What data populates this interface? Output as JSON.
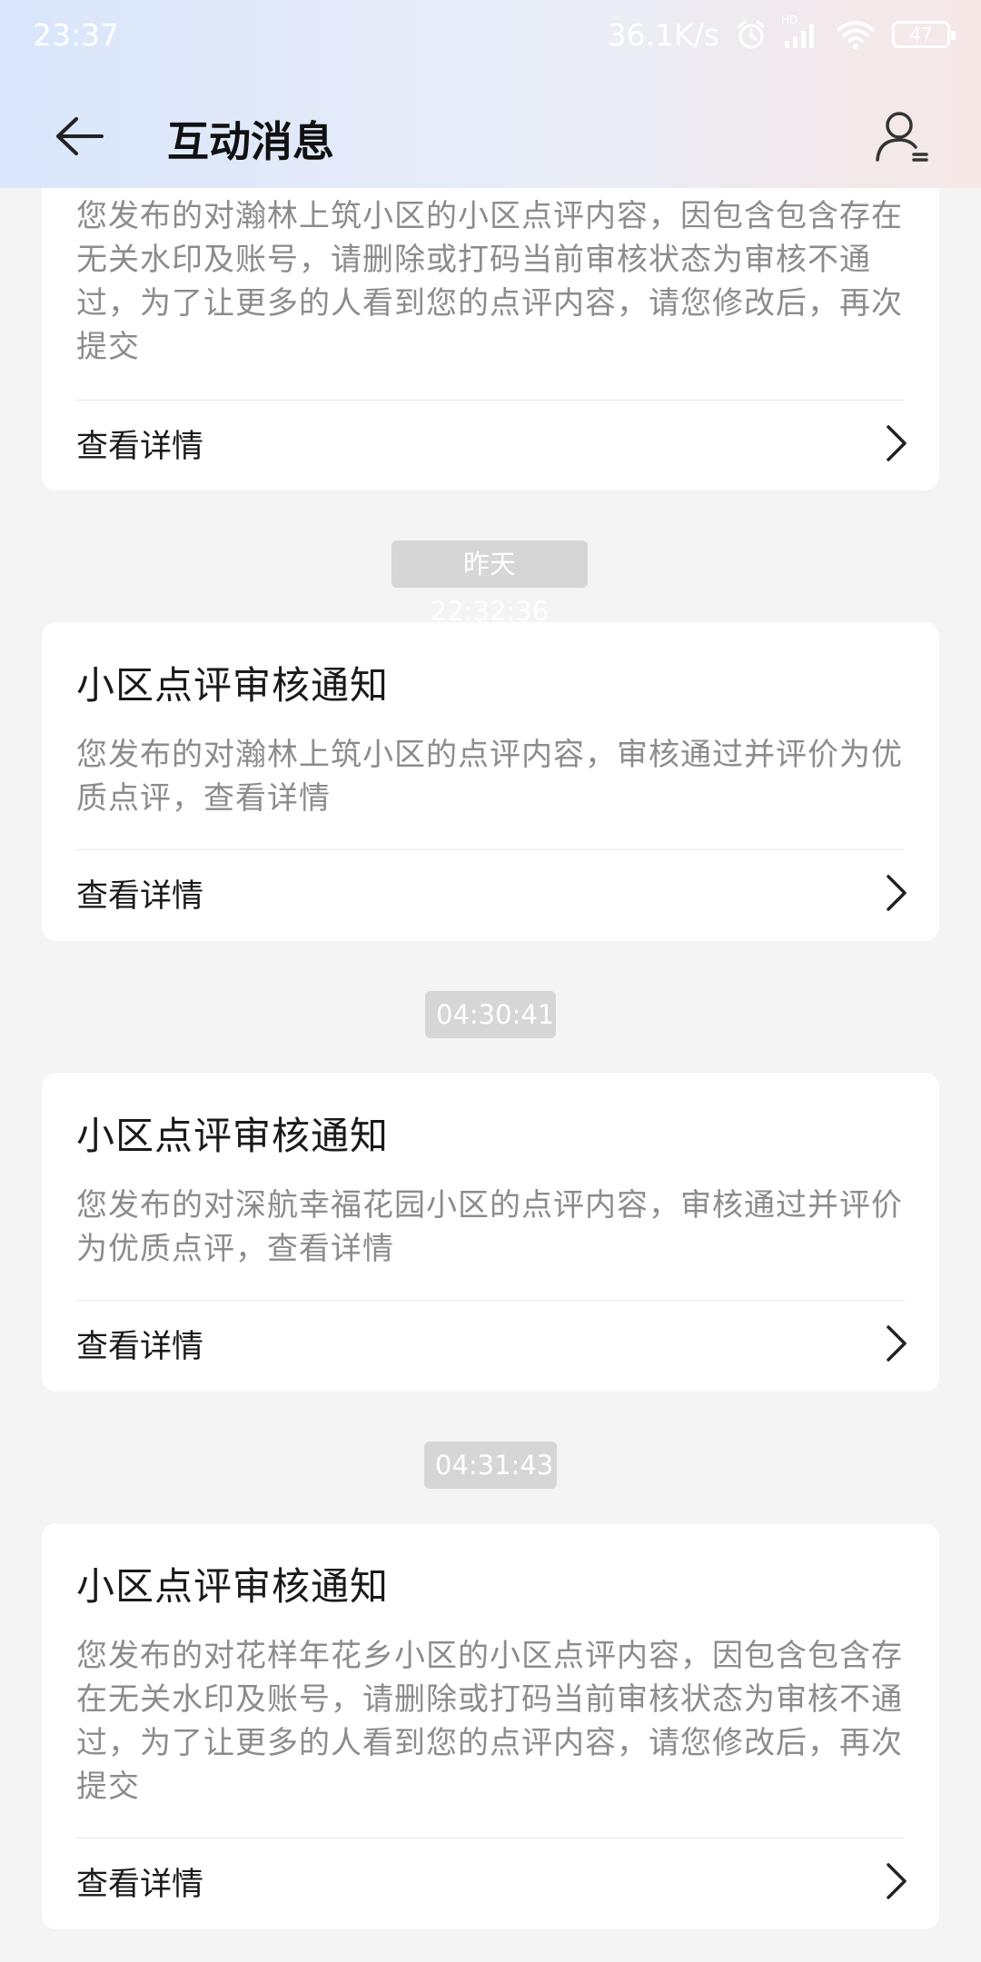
{
  "status_bar": {
    "time": "23:37",
    "net_speed": "36.1K/s",
    "hd_label": "HD",
    "battery": "47"
  },
  "header": {
    "title": "互动消息"
  },
  "cards": [
    {
      "title": "",
      "body": "您发布的对瀚林上筑小区的小区点评内容，因包含包含存在无关水印及账号，请删除或打码当前审核状态为审核不通过，为了让更多的人看到您的点评内容，请您修改后，再次提交",
      "action": "查看详情"
    },
    {
      "timestamp": "昨天 22:32:36",
      "title": "小区点评审核通知",
      "body": "您发布的对瀚林上筑小区的点评内容，审核通过并评价为优质点评，查看详情",
      "action": "查看详情"
    },
    {
      "timestamp": "04:30:41",
      "title": "小区点评审核通知",
      "body": "您发布的对深航幸福花园小区的点评内容，审核通过并评价为优质点评，查看详情",
      "action": "查看详情"
    },
    {
      "timestamp": "04:31:43",
      "title": "小区点评审核通知",
      "body": "您发布的对花样年花乡小区的小区点评内容，因包含包含存在无关水印及账号，请删除或打码当前审核状态为审核不通过，为了让更多的人看到您的点评内容，请您修改后，再次提交",
      "action": "查看详情"
    }
  ]
}
